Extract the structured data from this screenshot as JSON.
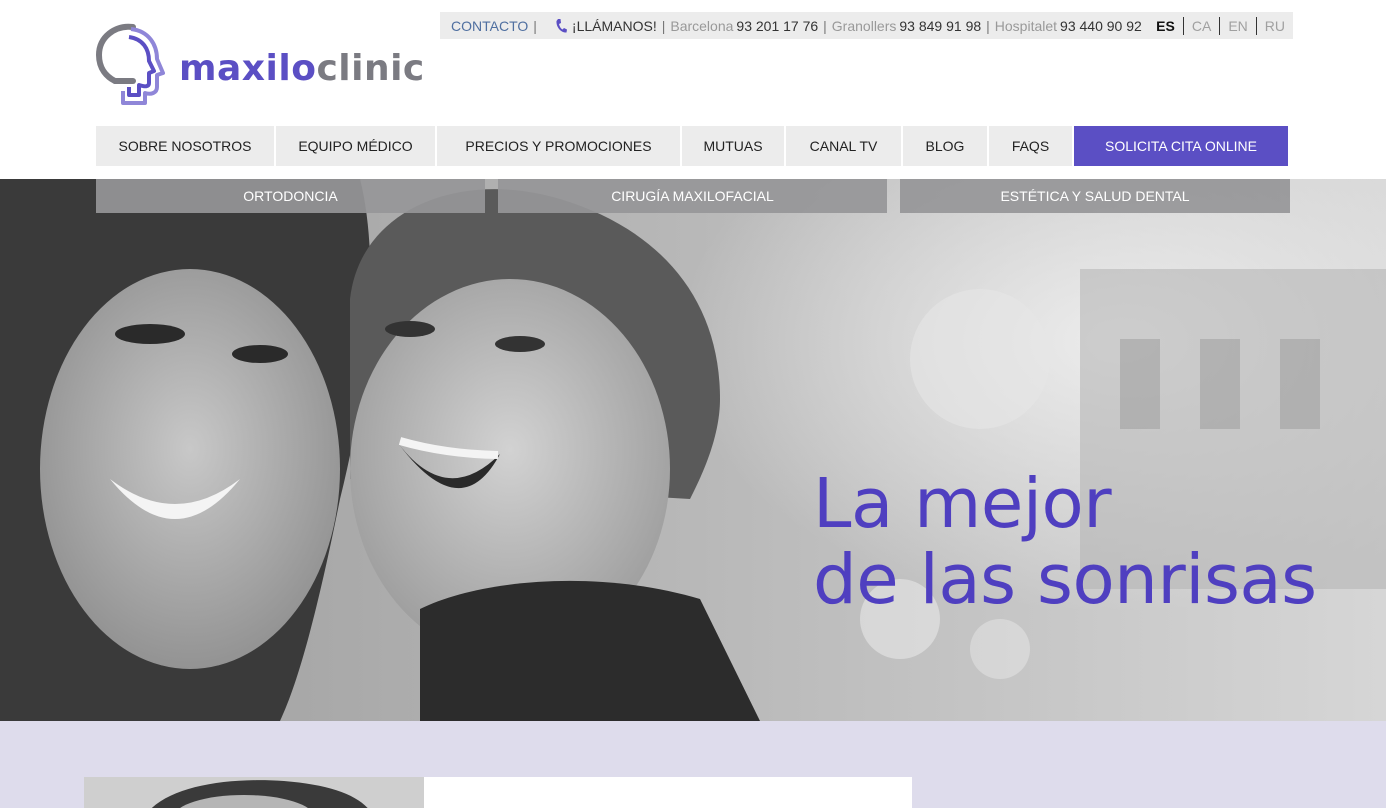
{
  "brand": {
    "name_part1": "maxilo",
    "name_part2": "clinic"
  },
  "topbar": {
    "contact": "CONTACTO",
    "sep": "|",
    "call_label": "¡LLÁMANOS!",
    "phones": [
      {
        "city": "Barcelona",
        "number": "93 201 17 76"
      },
      {
        "city": "Granollers",
        "number": "93 849 91 98"
      },
      {
        "city": "Hospitalet",
        "number": "93 440 90 92"
      }
    ],
    "languages": [
      {
        "code": "ES",
        "active": true
      },
      {
        "code": "CA",
        "active": false
      },
      {
        "code": "EN",
        "active": false
      },
      {
        "code": "RU",
        "active": false
      }
    ]
  },
  "nav": {
    "items": [
      "SOBRE NOSOTROS",
      "EQUIPO MÉDICO",
      "PRECIOS Y PROMOCIONES",
      "MUTUAS",
      "CANAL TV",
      "BLOG",
      "FAQS"
    ],
    "cta": "SOLICITA CITA ONLINE"
  },
  "subnav": [
    "ORTODONCIA",
    "CIRUGÍA MAXILOFACIAL",
    "ESTÉTICA Y SALUD DENTAL"
  ],
  "hero": {
    "line1": "La mejor",
    "line2": "de las sonrisas"
  },
  "colors": {
    "accent": "#5b4fc4",
    "headline": "#4f3fc0",
    "band": "#dedcec"
  }
}
